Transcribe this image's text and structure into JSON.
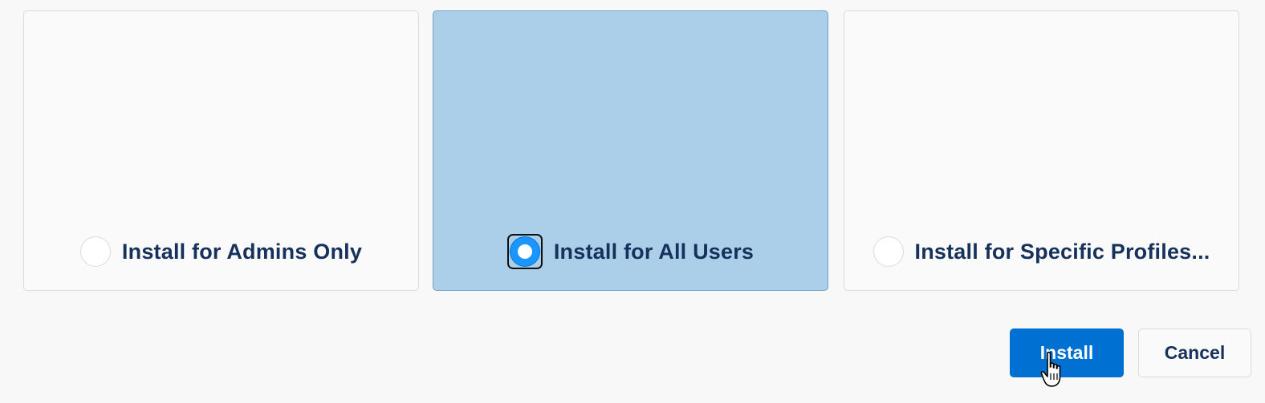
{
  "install_options": [
    {
      "id": "admins",
      "label": "Install for Admins Only",
      "selected": false
    },
    {
      "id": "all",
      "label": "Install for All Users",
      "selected": true
    },
    {
      "id": "profiles",
      "label": "Install for Specific Profiles...",
      "selected": false
    }
  ],
  "buttons": {
    "install_label": "Install",
    "cancel_label": "Cancel"
  },
  "colors": {
    "selected_card": "#abcfe9",
    "primary_button": "#0070d2",
    "radio_checked": "#1b96ff",
    "label_text": "#16325c"
  },
  "cursor": {
    "icon": "hand-pointer-icon"
  }
}
